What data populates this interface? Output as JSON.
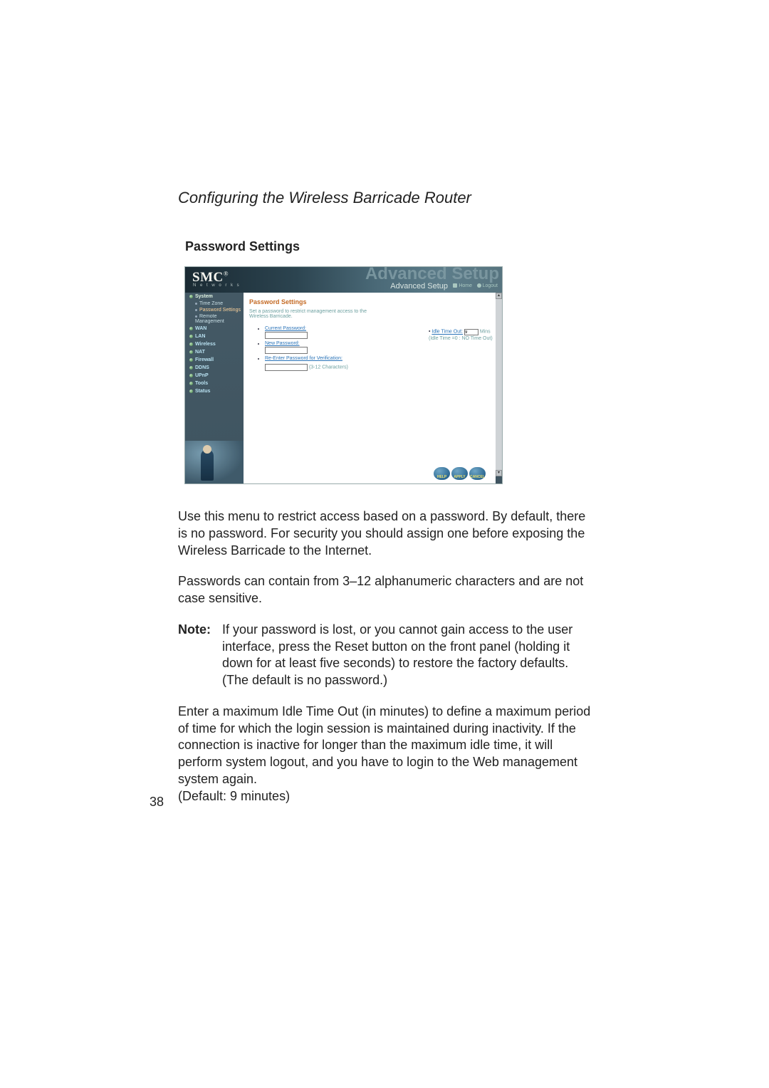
{
  "running_head": "Configuring the Wireless Barricade Router",
  "section_heading": "Password Settings",
  "page_number": "38",
  "screenshot": {
    "brand": "SMC",
    "brand_reg": "®",
    "brand_sub": "N e t w o r k s",
    "ghost_title": "Advanced Setup",
    "subtitle": "Advanced Setup",
    "header_links": {
      "home": "Home",
      "logout": "Logout"
    },
    "nav": {
      "system_label": "System",
      "system_children": [
        {
          "label": "Time Zone"
        },
        {
          "label": "Password Settings",
          "active": true
        },
        {
          "label": "Remote Management"
        }
      ],
      "items": [
        {
          "label": "WAN"
        },
        {
          "label": "LAN"
        },
        {
          "label": "Wireless"
        },
        {
          "label": "NAT"
        },
        {
          "label": "Firewall"
        },
        {
          "label": "DDNS"
        },
        {
          "label": "UPnP"
        },
        {
          "label": "Tools"
        },
        {
          "label": "Status"
        }
      ]
    },
    "panel": {
      "heading": "Password Settings",
      "description": "Set a password to restrict management access to the Wireless Barricade.",
      "current_label": "Current Password:",
      "new_label": "New Password:",
      "reenter_label": "Re-Enter Password for Verification:",
      "char_note": "(3-12 Characters)",
      "current_value": "",
      "new_value": "",
      "reenter_value": "",
      "idle_prefix": "• ",
      "idle_label": "Idle Time Out:",
      "idle_value": "9",
      "idle_mins": "Mins",
      "idle_note": "(Idle Time =0 : NO Time Out)"
    },
    "buttons": {
      "help": "HELP",
      "apply": "APPLY",
      "cancel": "CANCEL"
    },
    "scroll": {
      "up": "▴",
      "down": "▾"
    }
  },
  "body": {
    "p1": "Use this menu to restrict access based on a password. By default, there is no password. For security you should assign one before exposing the Wireless Barricade to the Internet.",
    "p2": "Passwords can contain from 3–12 alphanumeric characters and are not case sensitive.",
    "note_label": "Note:",
    "note_body": "If your password is lost, or you cannot gain access to the user interface, press the Reset button on the front panel (holding it down for at least five seconds) to restore the factory defaults. (The default is no password.)",
    "p3": "Enter a maximum Idle Time Out (in minutes) to define a maximum period of time for which the login session is maintained during inactivity. If the connection is inactive for longer than the maximum idle time, it will perform system logout, and you have to login to the Web management system again.\n(Default: 9 minutes)"
  }
}
